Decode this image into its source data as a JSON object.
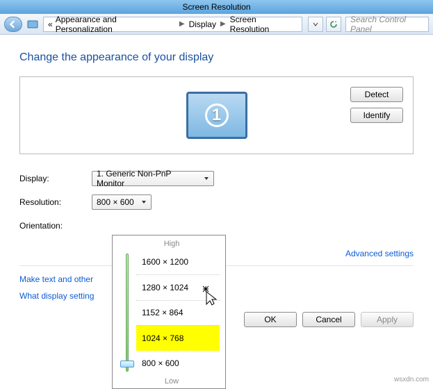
{
  "window_title": "Screen Resolution",
  "breadcrumb": {
    "level1": "Appearance and Personalization",
    "level2": "Display",
    "level3": "Screen Resolution"
  },
  "search_placeholder": "Search Control Panel",
  "page_title": "Change the appearance of your display",
  "monitor_number": "1",
  "side_buttons": {
    "detect": "Detect",
    "identify": "Identify"
  },
  "labels": {
    "display": "Display:",
    "resolution": "Resolution:",
    "orientation": "Orientation:"
  },
  "selects": {
    "display_value": "1. Generic Non-PnP Monitor",
    "resolution_value": "800 × 600"
  },
  "dropdown": {
    "high": "High",
    "low": "Low",
    "options": [
      "1600 × 1200",
      "1280 × 1024",
      "1152 × 864",
      "1024 × 768",
      "800 × 600"
    ]
  },
  "links": {
    "advanced": "Advanced settings",
    "text_other": "Make text and other",
    "what": "What display setting"
  },
  "buttons": {
    "ok": "OK",
    "cancel": "Cancel",
    "apply": "Apply"
  },
  "watermark": "wsxdn.com"
}
